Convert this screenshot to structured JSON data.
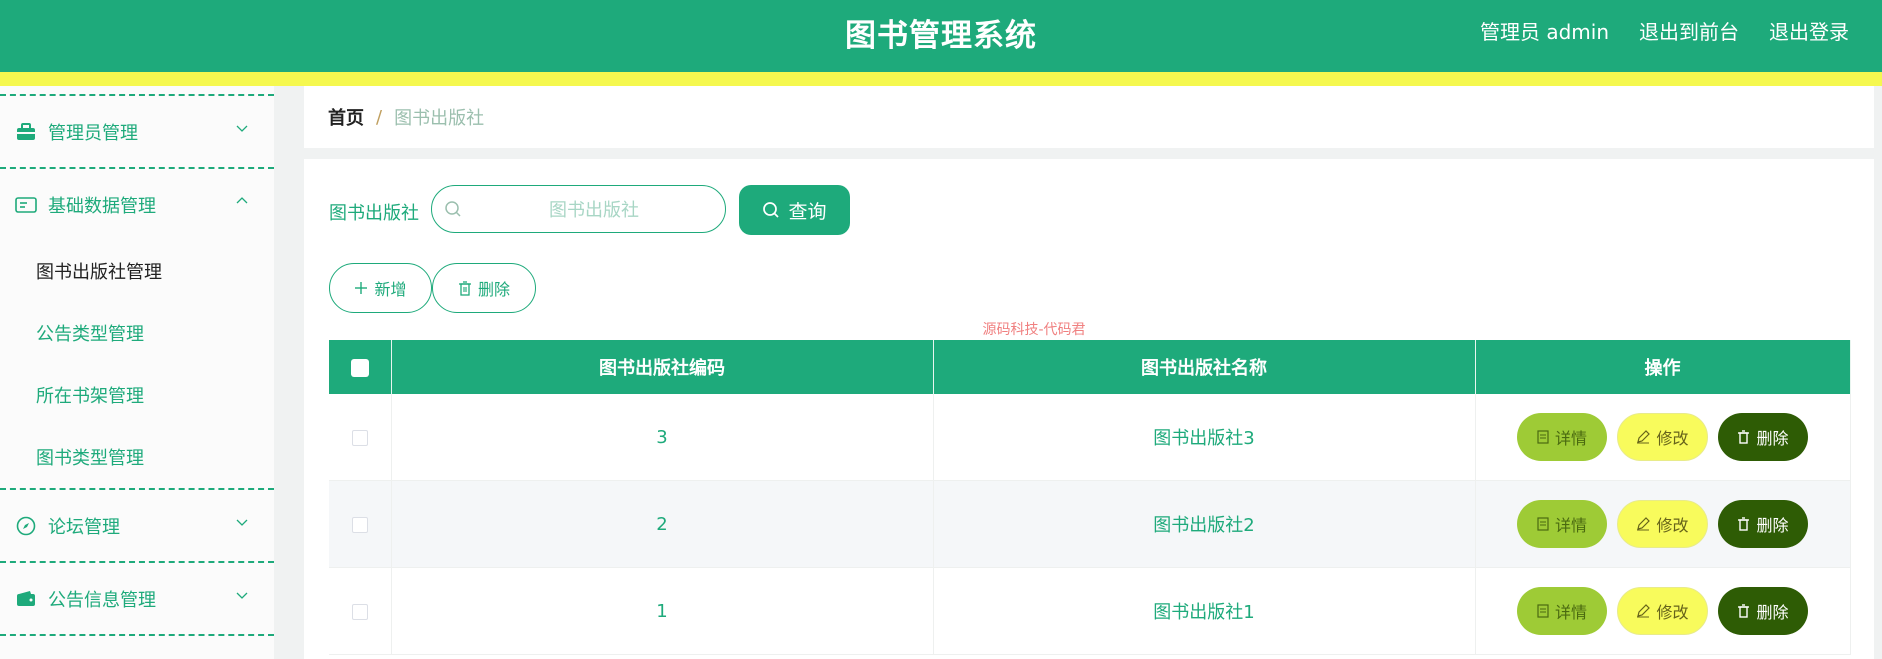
{
  "header": {
    "title": "图书管理系统",
    "user_label": "管理员 admin",
    "front_label": "退出到前台",
    "logout_label": "退出登录"
  },
  "sidebar": {
    "groups": [
      {
        "label": "管理员管理",
        "icon": "briefcase-icon",
        "expanded": false
      },
      {
        "label": "基础数据管理",
        "icon": "id-card-icon",
        "expanded": true,
        "items": [
          "图书出版社管理",
          "公告类型管理",
          "所在书架管理",
          "图书类型管理"
        ],
        "active_item": "图书出版社管理"
      },
      {
        "label": "论坛管理",
        "icon": "compass-icon",
        "expanded": false
      },
      {
        "label": "公告信息管理",
        "icon": "wallet-icon",
        "expanded": false
      }
    ]
  },
  "breadcrumb": {
    "home": "首页",
    "separator": "/",
    "current": "图书出版社"
  },
  "search": {
    "label": "图书出版社",
    "placeholder": "图书出版社",
    "value": "",
    "query_label": "查询"
  },
  "toolbar": {
    "add_label": "新增",
    "delete_label": "删除"
  },
  "watermark": "源码科技-代码君",
  "table": {
    "columns": [
      "图书出版社编码",
      "图书出版社名称",
      "操作"
    ],
    "rows": [
      {
        "code": "3",
        "name": "图书出版社3"
      },
      {
        "code": "2",
        "name": "图书出版社2"
      },
      {
        "code": "1",
        "name": "图书出版社1"
      }
    ],
    "actions": {
      "detail": "详情",
      "edit": "修改",
      "delete": "删除"
    }
  },
  "colors": {
    "primary": "#1eaa7b",
    "accent_strip": "#f5f84f",
    "detail_button": "#9ecb36",
    "edit_button": "#f8fb5c",
    "delete_button": "#2e5c05"
  }
}
